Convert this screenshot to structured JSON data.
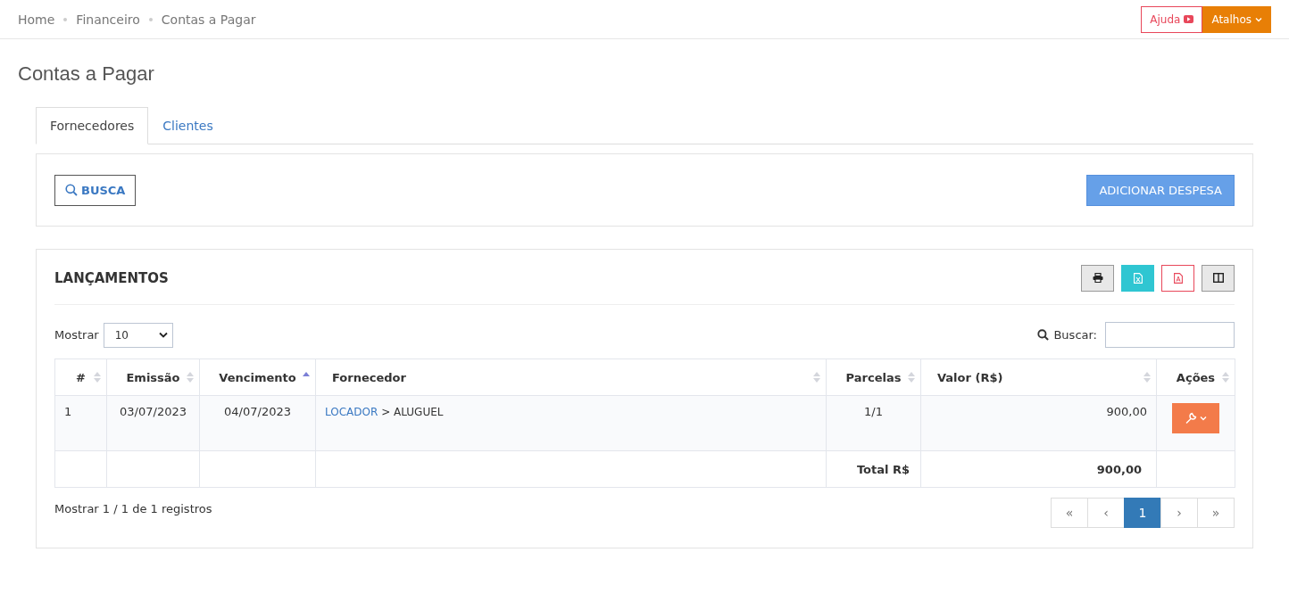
{
  "breadcrumb": [
    "Home",
    "Financeiro",
    "Contas a Pagar"
  ],
  "header_buttons": {
    "help": "Ajuda",
    "shortcuts": "Atalhos"
  },
  "page_title": "Contas a Pagar",
  "tabs": [
    {
      "label": "Fornecedores",
      "selected": true
    },
    {
      "label": "Clientes",
      "selected": false
    }
  ],
  "search_button": "BUSCA",
  "add_button": "ADICIONAR DESPESA",
  "entries": {
    "title": "LANÇAMENTOS",
    "show_label": "Mostrar",
    "page_size": "10",
    "search_label": "Buscar:",
    "columns": [
      {
        "label": "#",
        "sorted": false
      },
      {
        "label": "Emissão",
        "sorted": false
      },
      {
        "label": "Vencimento",
        "sorted": true
      },
      {
        "label": "Fornecedor",
        "sorted": false
      },
      {
        "label": "Parcelas",
        "sorted": false
      },
      {
        "label": "Valor (R$)",
        "sorted": false
      },
      {
        "label": "Ações",
        "sorted": false
      }
    ],
    "rows": [
      {
        "number": "1",
        "issue": "03/07/2023",
        "due": "04/07/2023",
        "supplier": "LOCADOR",
        "category": "> ALUGUEL",
        "installments": "1/1",
        "amount": "900,00"
      }
    ],
    "total_label": "Total R$",
    "total": "900,00",
    "info": "Mostrar 1 / 1 de 1 registros",
    "pagination": [
      {
        "label": "«",
        "selected": false
      },
      {
        "label": "‹",
        "selected": false
      },
      {
        "label": "1",
        "selected": true
      },
      {
        "label": "›",
        "selected": false
      },
      {
        "label": "»",
        "selected": false
      }
    ]
  }
}
